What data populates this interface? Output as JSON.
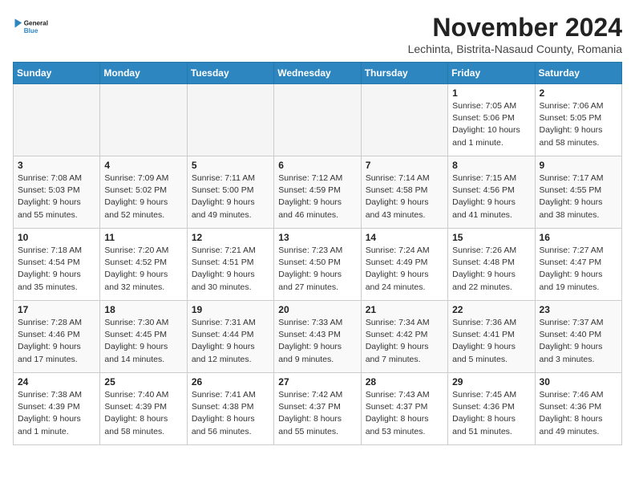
{
  "logo": {
    "text_general": "General",
    "text_blue": "Blue"
  },
  "header": {
    "month_title": "November 2024",
    "subtitle": "Lechinta, Bistrita-Nasaud County, Romania"
  },
  "weekdays": [
    "Sunday",
    "Monday",
    "Tuesday",
    "Wednesday",
    "Thursday",
    "Friday",
    "Saturday"
  ],
  "weeks": [
    [
      {
        "day": "",
        "info": ""
      },
      {
        "day": "",
        "info": ""
      },
      {
        "day": "",
        "info": ""
      },
      {
        "day": "",
        "info": ""
      },
      {
        "day": "",
        "info": ""
      },
      {
        "day": "1",
        "info": "Sunrise: 7:05 AM\nSunset: 5:06 PM\nDaylight: 10 hours and 1 minute."
      },
      {
        "day": "2",
        "info": "Sunrise: 7:06 AM\nSunset: 5:05 PM\nDaylight: 9 hours and 58 minutes."
      }
    ],
    [
      {
        "day": "3",
        "info": "Sunrise: 7:08 AM\nSunset: 5:03 PM\nDaylight: 9 hours and 55 minutes."
      },
      {
        "day": "4",
        "info": "Sunrise: 7:09 AM\nSunset: 5:02 PM\nDaylight: 9 hours and 52 minutes."
      },
      {
        "day": "5",
        "info": "Sunrise: 7:11 AM\nSunset: 5:00 PM\nDaylight: 9 hours and 49 minutes."
      },
      {
        "day": "6",
        "info": "Sunrise: 7:12 AM\nSunset: 4:59 PM\nDaylight: 9 hours and 46 minutes."
      },
      {
        "day": "7",
        "info": "Sunrise: 7:14 AM\nSunset: 4:58 PM\nDaylight: 9 hours and 43 minutes."
      },
      {
        "day": "8",
        "info": "Sunrise: 7:15 AM\nSunset: 4:56 PM\nDaylight: 9 hours and 41 minutes."
      },
      {
        "day": "9",
        "info": "Sunrise: 7:17 AM\nSunset: 4:55 PM\nDaylight: 9 hours and 38 minutes."
      }
    ],
    [
      {
        "day": "10",
        "info": "Sunrise: 7:18 AM\nSunset: 4:54 PM\nDaylight: 9 hours and 35 minutes."
      },
      {
        "day": "11",
        "info": "Sunrise: 7:20 AM\nSunset: 4:52 PM\nDaylight: 9 hours and 32 minutes."
      },
      {
        "day": "12",
        "info": "Sunrise: 7:21 AM\nSunset: 4:51 PM\nDaylight: 9 hours and 30 minutes."
      },
      {
        "day": "13",
        "info": "Sunrise: 7:23 AM\nSunset: 4:50 PM\nDaylight: 9 hours and 27 minutes."
      },
      {
        "day": "14",
        "info": "Sunrise: 7:24 AM\nSunset: 4:49 PM\nDaylight: 9 hours and 24 minutes."
      },
      {
        "day": "15",
        "info": "Sunrise: 7:26 AM\nSunset: 4:48 PM\nDaylight: 9 hours and 22 minutes."
      },
      {
        "day": "16",
        "info": "Sunrise: 7:27 AM\nSunset: 4:47 PM\nDaylight: 9 hours and 19 minutes."
      }
    ],
    [
      {
        "day": "17",
        "info": "Sunrise: 7:28 AM\nSunset: 4:46 PM\nDaylight: 9 hours and 17 minutes."
      },
      {
        "day": "18",
        "info": "Sunrise: 7:30 AM\nSunset: 4:45 PM\nDaylight: 9 hours and 14 minutes."
      },
      {
        "day": "19",
        "info": "Sunrise: 7:31 AM\nSunset: 4:44 PM\nDaylight: 9 hours and 12 minutes."
      },
      {
        "day": "20",
        "info": "Sunrise: 7:33 AM\nSunset: 4:43 PM\nDaylight: 9 hours and 9 minutes."
      },
      {
        "day": "21",
        "info": "Sunrise: 7:34 AM\nSunset: 4:42 PM\nDaylight: 9 hours and 7 minutes."
      },
      {
        "day": "22",
        "info": "Sunrise: 7:36 AM\nSunset: 4:41 PM\nDaylight: 9 hours and 5 minutes."
      },
      {
        "day": "23",
        "info": "Sunrise: 7:37 AM\nSunset: 4:40 PM\nDaylight: 9 hours and 3 minutes."
      }
    ],
    [
      {
        "day": "24",
        "info": "Sunrise: 7:38 AM\nSunset: 4:39 PM\nDaylight: 9 hours and 1 minute."
      },
      {
        "day": "25",
        "info": "Sunrise: 7:40 AM\nSunset: 4:39 PM\nDaylight: 8 hours and 58 minutes."
      },
      {
        "day": "26",
        "info": "Sunrise: 7:41 AM\nSunset: 4:38 PM\nDaylight: 8 hours and 56 minutes."
      },
      {
        "day": "27",
        "info": "Sunrise: 7:42 AM\nSunset: 4:37 PM\nDaylight: 8 hours and 55 minutes."
      },
      {
        "day": "28",
        "info": "Sunrise: 7:43 AM\nSunset: 4:37 PM\nDaylight: 8 hours and 53 minutes."
      },
      {
        "day": "29",
        "info": "Sunrise: 7:45 AM\nSunset: 4:36 PM\nDaylight: 8 hours and 51 minutes."
      },
      {
        "day": "30",
        "info": "Sunrise: 7:46 AM\nSunset: 4:36 PM\nDaylight: 8 hours and 49 minutes."
      }
    ]
  ]
}
